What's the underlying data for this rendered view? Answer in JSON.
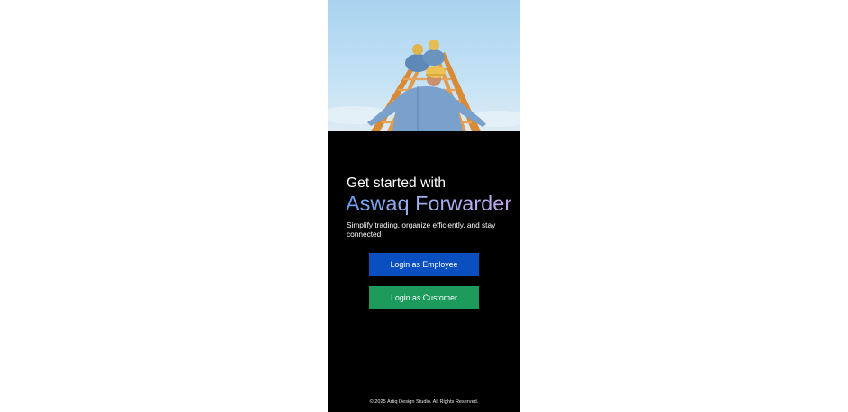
{
  "hero": {
    "image_description_icon": "construction-workers-climbing-ladder-image"
  },
  "heading": {
    "line1": "Get started with",
    "brand": "Aswaq Forwarder"
  },
  "tagline": "Simplify trading, organize efficiently, and stay connected",
  "buttons": {
    "employee_label": "Login as Employee",
    "customer_label": "Login as Customer"
  },
  "footer": "© 2025 Artiq Design Studio. All Rights Reserved.",
  "colors": {
    "background": "#000000",
    "employee_button": "#0a4fbf",
    "customer_button": "#1c9b5c",
    "brand_gradient_start": "#6d9df0",
    "brand_gradient_end": "#c4a7ea"
  }
}
